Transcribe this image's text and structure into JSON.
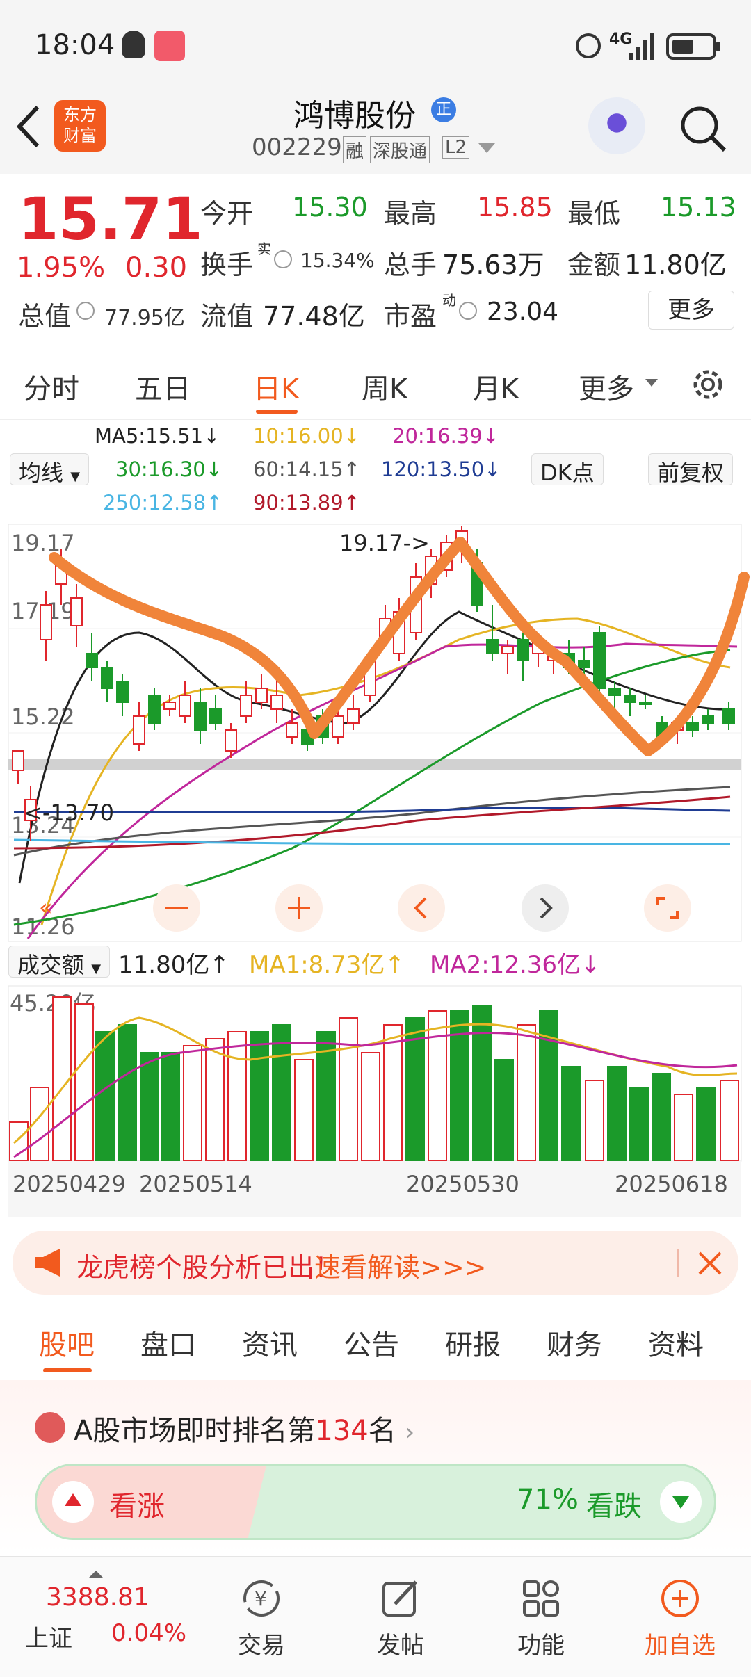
{
  "status": {
    "time": "18:04",
    "network": "4G"
  },
  "header": {
    "logo_line1": "东方",
    "logo_line2": "财富",
    "name": "鸿博股份",
    "badge": "正",
    "code": "002229",
    "tags": [
      "融",
      "深股通",
      "L2"
    ]
  },
  "quote": {
    "price": "15.71",
    "change_pct": "1.95%",
    "change": "0.30",
    "open_label": "今开",
    "open": "15.30",
    "high_label": "最高",
    "high": "15.85",
    "low_label": "最低",
    "low": "15.13",
    "turnover_label": "换手",
    "turnover_sup": "实",
    "turnover": "15.34%",
    "volume_label": "总手",
    "volume": "75.63万",
    "amount_label": "金额",
    "amount": "11.80亿",
    "mktcap_label": "总值",
    "mktcap": "77.95亿",
    "float_label": "流值",
    "float_cap": "77.48亿",
    "pe_label": "市盈",
    "pe_sup": "动",
    "pe": "23.04",
    "more": "更多"
  },
  "tabs": [
    "分时",
    "五日",
    "日K",
    "周K",
    "月K",
    "更多"
  ],
  "active_tab": "日K",
  "indicators": {
    "ma_button": "均线",
    "ma5": "MA5:15.51↓",
    "ma10": "10:16.00↓",
    "ma20": "20:16.39↓",
    "ma30": "30:16.30↓",
    "ma60": "60:14.15↑",
    "ma120": "120:13.50↓",
    "ma250": "250:12.58↑",
    "ma90": "90:13.89↑",
    "dk_button": "DK点",
    "adjust_button": "前复权"
  },
  "price_chart": {
    "y_labels": [
      "19.17",
      "17.19",
      "15.22",
      "13.24",
      "11.26"
    ],
    "high_marker": "19.17->",
    "low_marker": "<-13.70"
  },
  "volume_chart": {
    "indicator_button": "成交额",
    "current": "11.80亿↑",
    "ma1": "MA1:8.73亿↑",
    "ma2": "MA2:12.36亿↓",
    "max_label": "45.20亿",
    "dates": [
      "20250429",
      "20250514",
      "20250530",
      "20250618"
    ]
  },
  "colors": {
    "up": "#e0262d",
    "down": "#1b9a2a",
    "accent": "#f25a1e",
    "annotation": "#f0843a"
  },
  "banner": {
    "text": "龙虎榜个股分析已出！",
    "link": "速看解读>>>"
  },
  "subtabs": [
    "股吧",
    "盘口",
    "资讯",
    "公告",
    "研报",
    "财务",
    "资料"
  ],
  "active_subtab": "股吧",
  "rank": {
    "prefix": "A股市场即时排名第",
    "number": "134",
    "suffix": "名"
  },
  "sentiment": {
    "bull": "看涨",
    "bear_pct": "71%",
    "bear": "看跌"
  },
  "bottom_nav": {
    "index_value": "3388.81",
    "index_name": "上证",
    "index_change": "0.04%",
    "items": [
      "交易",
      "发帖",
      "功能",
      "加自选"
    ]
  }
}
